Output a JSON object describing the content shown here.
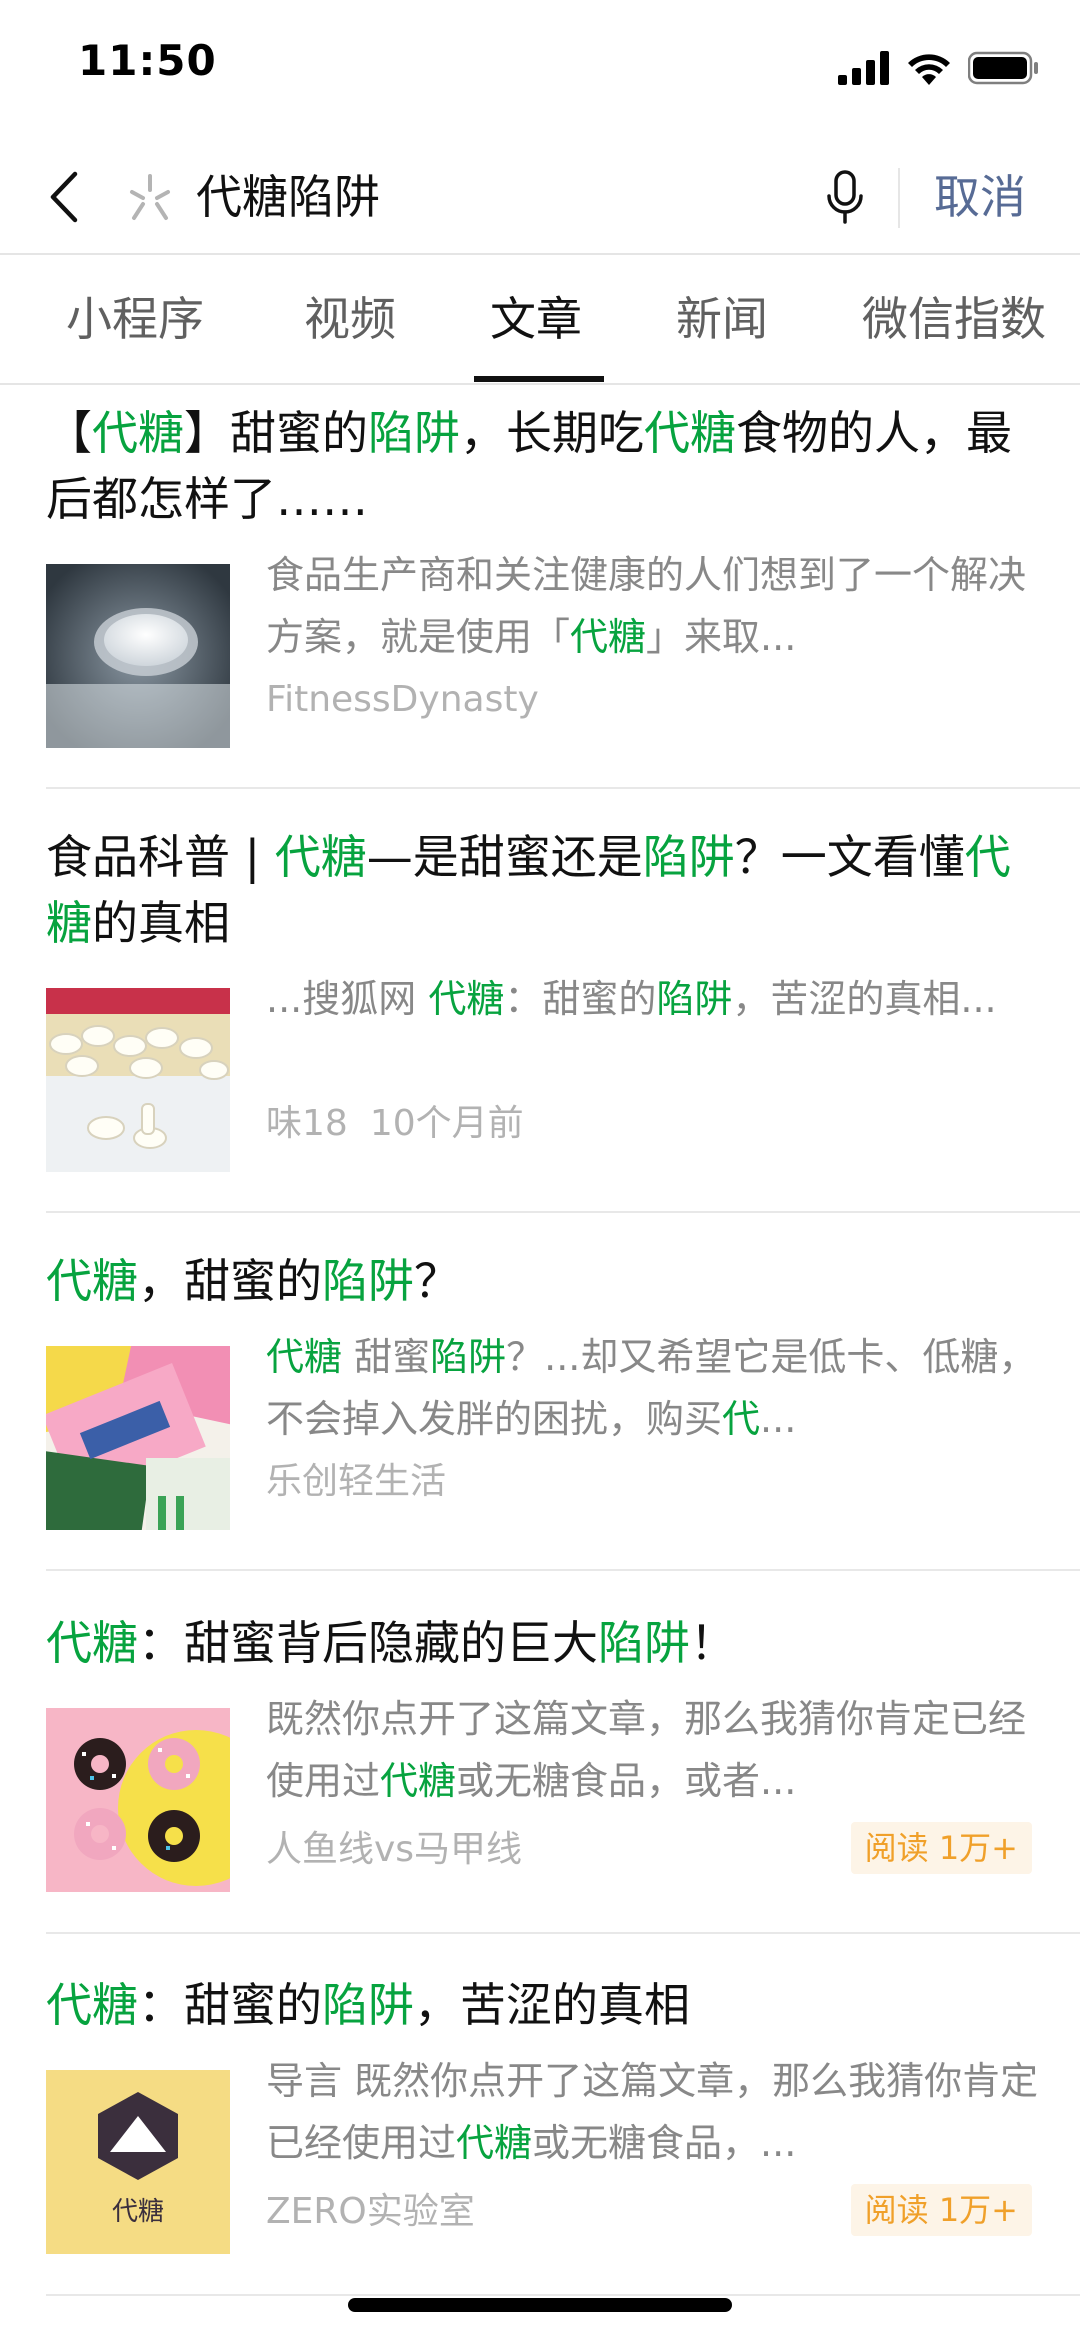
{
  "status_bar": {
    "time": "11:50"
  },
  "search": {
    "query": "代糖陷阱",
    "cancel_label": "取消",
    "icons": {
      "back": "back-chevron-icon",
      "search": "spark-search-icon",
      "mic": "microphone-icon"
    }
  },
  "tabs": [
    {
      "label": "小程序",
      "active": false
    },
    {
      "label": "视频",
      "active": false
    },
    {
      "label": "文章",
      "active": true
    },
    {
      "label": "新闻",
      "active": false
    },
    {
      "label": "微信指数",
      "active": false
    }
  ],
  "colors": {
    "highlight": "#07a33f",
    "cancel": "#576b95",
    "badge_text": "#f0a02a",
    "badge_bg": "#fdf4e7"
  },
  "articles": [
    {
      "title_parts": [
        "【",
        "代糖",
        "】甜蜜的",
        "陷阱",
        "，长期吃",
        "代糖",
        "食物的人，最后都怎样了……"
      ],
      "snippet_parts": [
        "食品生产商和关注健康的人们想到了一个解决方案，就是使用「",
        "代糖",
        "」来取..."
      ],
      "source": "FitnessDynasty",
      "time": "",
      "read_badge": "",
      "thumb": "sugar-spoon-image"
    },
    {
      "title_parts": [
        "食品科普 | ",
        "代糖",
        "—是甜蜜还是",
        "陷阱",
        "？一文看懂",
        "代糖",
        "的真相"
      ],
      "snippet_parts": [
        "...搜狐网 ",
        "代糖",
        "：甜蜜的",
        "陷阱",
        "，苦涩的真相..."
      ],
      "source": "味18",
      "time": "10个月前",
      "read_badge": "",
      "thumb": "sweetener-tablets-image"
    },
    {
      "title_parts": [
        "",
        "代糖",
        "，甜蜜的",
        "陷阱",
        "？"
      ],
      "snippet_parts": [
        "",
        "代糖",
        " 甜蜜",
        "陷阱",
        "？...却又希望它是低卡、低糖，不会掉入发胖的困扰，购买",
        "代",
        "..."
      ],
      "source": "乐创轻生活",
      "time": "",
      "read_badge": "",
      "thumb": "sweetener-packets-image"
    },
    {
      "title_parts": [
        "",
        "代糖",
        "：甜蜜背后隐藏的巨大",
        "陷阱",
        "！"
      ],
      "snippet_parts": [
        "既然你点开了这篇文章，那么我猜你肯定已经使用过",
        "代糖",
        "或无糖食品，或者..."
      ],
      "source": "人鱼线vs马甲线",
      "time": "",
      "read_badge": "阅读 1万+",
      "thumb": "donuts-image"
    },
    {
      "title_parts": [
        "",
        "代糖",
        "：甜蜜的",
        "陷阱",
        "，苦涩的真相"
      ],
      "snippet_parts": [
        "导言 既然你点开了这篇文章，那么我猜你肯定已经使用过",
        "代糖",
        "或无糖食品，..."
      ],
      "source": "ZERO实验室",
      "time": "",
      "read_badge": "阅读 1万+",
      "thumb": "logo-image",
      "thumb_logo_text": "代糖"
    }
  ]
}
